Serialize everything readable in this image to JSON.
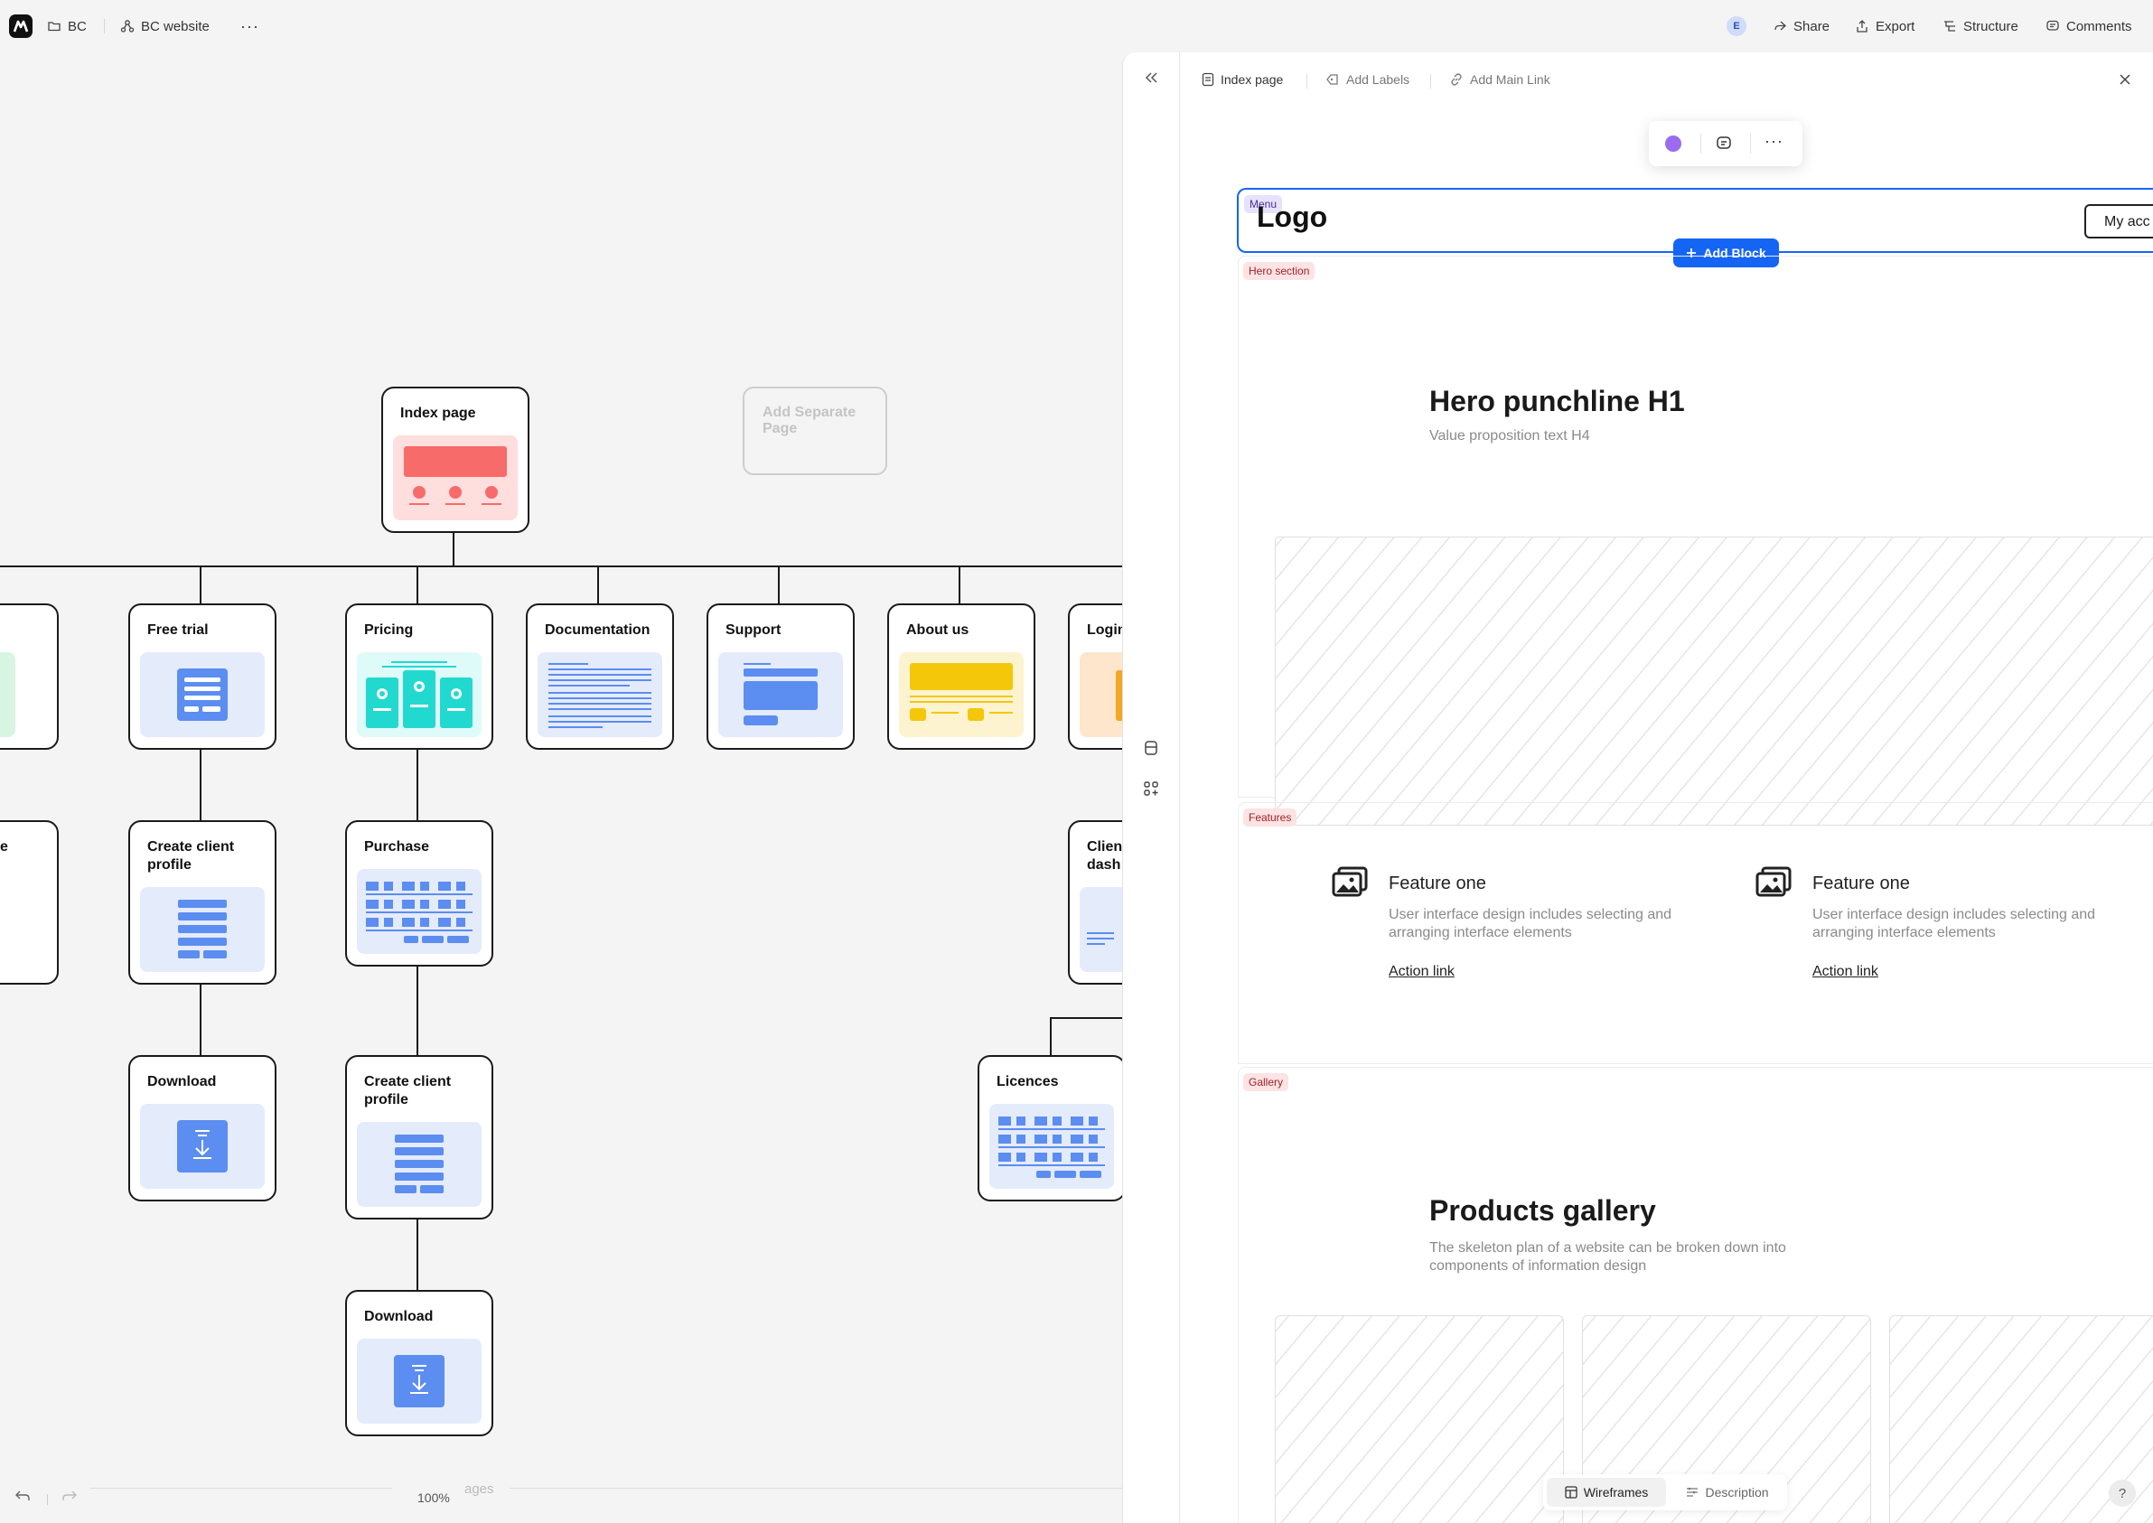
{
  "topbar": {
    "folder": "BC",
    "project": "BC website",
    "more": "···",
    "avatar": "E",
    "share": "Share",
    "export": "Export",
    "structure": "Structure",
    "comments": "Comments"
  },
  "sitemap": {
    "root": "Index page",
    "add_separate": "Add Separate Page",
    "partial_left_top": "",
    "partial_left_bottom": "e",
    "nodes": {
      "free_trial": "Free trial",
      "pricing": "Pricing",
      "documentation": "Documentation",
      "support": "Support",
      "about_us": "About us",
      "login": "Login",
      "create_profile_a": "Create client profile",
      "purchase": "Purchase",
      "client_dash": "Client dash",
      "download_a": "Download",
      "create_profile_b": "Create client profile",
      "licences": "Licences",
      "download_b": "Download"
    }
  },
  "bottombar": {
    "zoom": "100%",
    "pages_label": "ages"
  },
  "panel": {
    "tabs": {
      "page": "Index page",
      "labels": "Add Labels",
      "main_link": "Add Main Link"
    },
    "floating_toolbar": {
      "color": "#9b6bf0"
    },
    "menu": {
      "badge": "Menu",
      "logo": "Logo",
      "account": "My acc",
      "add_block": "Add Block"
    },
    "hero": {
      "badge": "Hero section",
      "title": "Hero punchline H1",
      "subtitle": "Value proposition text H4"
    },
    "features": {
      "badge": "Features",
      "items": [
        {
          "title": "Feature one",
          "desc": "User interface design includes selecting and arranging interface elements",
          "link": "Action link"
        },
        {
          "title": "Feature one",
          "desc": "User interface design includes selecting and arranging interface elements",
          "link": "Action link"
        }
      ]
    },
    "gallery": {
      "badge": "Gallery",
      "title": "Products gallery",
      "desc": "The skeleton plan of a website can be broken down into components of information design"
    },
    "bottom_tabs": {
      "wireframes": "Wireframes",
      "description": "Description"
    },
    "help": "?"
  },
  "colors": {
    "accent": "#1565f5",
    "index_thumb": "#ffdede",
    "green_thumb": "#d8f5e2",
    "blue_thumb": "#e4ebfb",
    "cyan_thumb": "#dffbf9",
    "yellow_thumb": "#fdf3cf",
    "orange_thumb": "#fde6cc"
  },
  "icons": [
    "folder-icon",
    "sitemap-icon",
    "share-icon",
    "export-icon",
    "structure-icon",
    "comment-icon",
    "undo-icon",
    "redo-icon",
    "collapse-icon",
    "page-icon",
    "label-icon",
    "link-icon",
    "close-icon",
    "print-icon",
    "add-widget-icon",
    "chat-icon",
    "image-icon",
    "wireframe-icon",
    "description-icon",
    "help-icon"
  ]
}
